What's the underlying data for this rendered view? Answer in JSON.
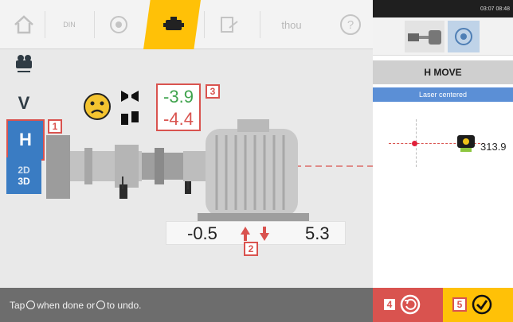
{
  "toolbar": {
    "items": [
      {
        "label": "",
        "icon": "home-icon"
      },
      {
        "label": "DIN",
        "icon": "din-icon"
      },
      {
        "label": "",
        "icon": "machine-icon"
      },
      {
        "label": "",
        "icon": "alignment-move-icon"
      },
      {
        "label": "",
        "icon": "report-icon"
      },
      {
        "label": "thou",
        "icon": ""
      },
      {
        "label": "?",
        "icon": "help-icon"
      }
    ],
    "active": "alignment-move-icon"
  },
  "left": {
    "v_label": "V",
    "h_label": "H",
    "mode_2d": "2D",
    "mode_3d": "3D"
  },
  "callouts": [
    "1",
    "2",
    "3",
    "4",
    "5"
  ],
  "coupling": {
    "angularity": "-3.9",
    "offset": "-4.4",
    "smiley": "bad"
  },
  "feet": {
    "front": "-0.5",
    "back": "5.3"
  },
  "status": {
    "text_before": "Tap",
    "text_middle": "when done or",
    "text_after": "to undo."
  },
  "right_panel": {
    "android_status": "03:07 08:48",
    "title": "H MOVE",
    "laser_status": "Laser centered",
    "reading": "313.9"
  },
  "colors": {
    "accent": "#ffc107",
    "selected": "#3a7cc3",
    "undo": "#d9534f",
    "laser_bar": "#5b8fd6",
    "good_value": "#3fa34d",
    "bad_value": "#d9534f"
  }
}
